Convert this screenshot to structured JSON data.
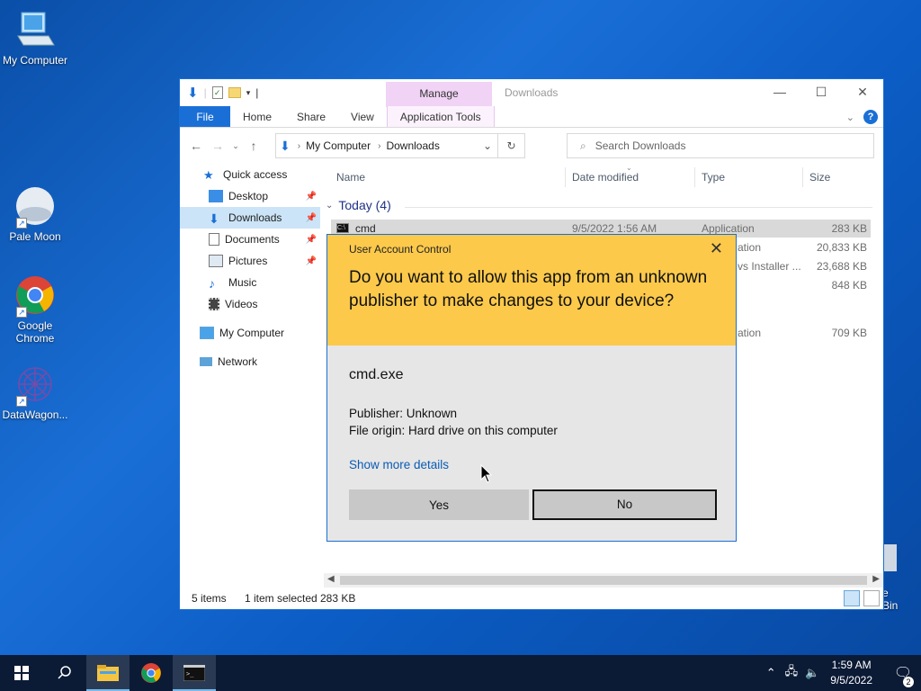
{
  "desktop": {
    "icons": [
      {
        "label": "My Computer"
      },
      {
        "label": "Pale Moon"
      },
      {
        "label": "Google Chrome"
      },
      {
        "label": "DataWagon..."
      }
    ],
    "recycle_bin_partial": "e Bin"
  },
  "explorer": {
    "context_tab": "Manage",
    "window_title": "Downloads",
    "tabs": [
      "File",
      "Home",
      "Share",
      "View",
      "Application Tools"
    ],
    "address": {
      "root": "My Computer",
      "current": "Downloads"
    },
    "search_placeholder": "Search Downloads",
    "nav": {
      "quick_access": "Quick access",
      "items": [
        "Desktop",
        "Downloads",
        "Documents",
        "Pictures",
        "Music",
        "Videos"
      ],
      "my_computer": "My Computer",
      "network": "Network"
    },
    "columns": {
      "name": "Name",
      "date": "Date modified",
      "type": "Type",
      "size": "Size"
    },
    "group": "Today (4)",
    "files": [
      {
        "name": "cmd",
        "date": "9/5/2022 1:56 AM",
        "type": "Application",
        "size": "283 KB"
      },
      {
        "name": "",
        "date": "",
        "type": "ation",
        "size": "20,833 KB"
      },
      {
        "name": "",
        "date": "",
        "type": "vs Installer ...",
        "size": "23,688 KB"
      },
      {
        "name": "",
        "date": "",
        "type": "",
        "size": "848 KB"
      },
      {
        "name": "",
        "date": "",
        "type": "ation",
        "size": "709 KB"
      }
    ],
    "status": {
      "items": "5 items",
      "selected": "1 item selected",
      "size": "283 KB"
    }
  },
  "uac": {
    "title": "User Account Control",
    "question": "Do you want to allow this app from an unknown publisher to make changes to your device?",
    "app_name": "cmd.exe",
    "publisher": "Publisher: Unknown",
    "origin": "File origin: Hard drive on this computer",
    "details_link": "Show more details",
    "yes_label": "Yes",
    "no_label": "No",
    "header_color": "#fcc94b"
  },
  "taskbar": {
    "time": "1:59 AM",
    "date": "9/5/2022",
    "notification_count": "2"
  }
}
